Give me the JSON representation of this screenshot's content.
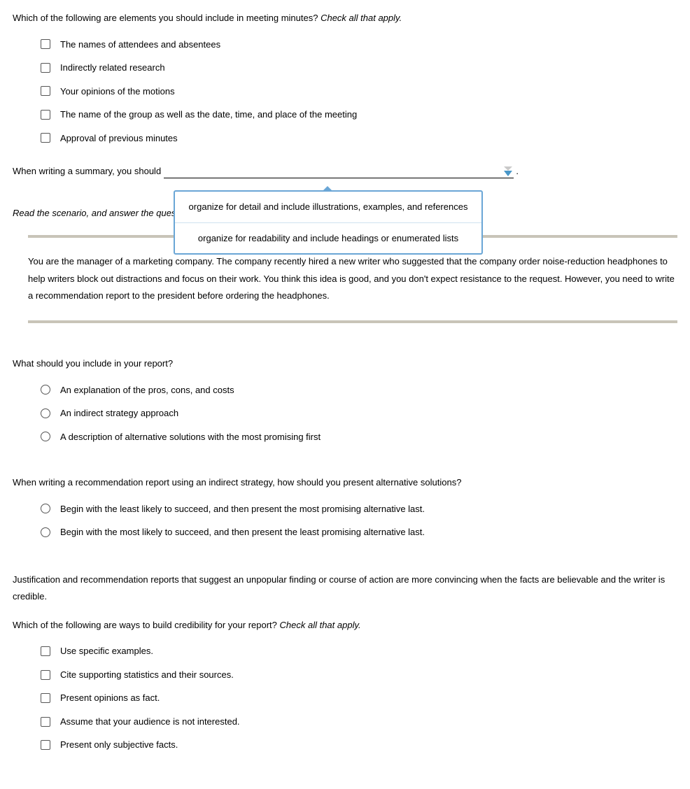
{
  "q1": {
    "text": "Which of the following are elements you should include in meeting minutes? ",
    "hint": "Check all that apply.",
    "options": [
      "The names of attendees and absentees",
      "Indirectly related research",
      "Your opinions of the motions",
      "The name of the group as well as the date, time, and place of the meeting",
      "Approval of previous minutes"
    ]
  },
  "q2": {
    "before": "When writing a summary, you should ",
    "after": " .",
    "dropdown": [
      "organize for detail and include illustrations, examples, and references",
      "organize for readability and include headings or enumerated lists"
    ]
  },
  "scenario": {
    "prompt": "Read the scenario, and answer the question.",
    "body": "You are the manager of a marketing company. The company recently hired a new writer who suggested that the company order noise-reduction headphones to help writers block out distractions and focus on their work. You think this idea is good, and you don't expect resistance to the request. However, you need to write a recommendation report to the president before ordering the headphones."
  },
  "q3": {
    "text": "What should you include in your report?",
    "options": [
      "An explanation of the pros, cons, and costs",
      "An indirect strategy approach",
      "A description of alternative solutions with the most promising first"
    ]
  },
  "q4": {
    "text": "When writing a recommendation report using an indirect strategy, how should you present alternative solutions?",
    "options": [
      "Begin with the least likely to succeed, and then present the most promising alternative last.",
      "Begin with the most likely to succeed, and then present the least promising alternative last."
    ]
  },
  "q5": {
    "intro": "Justification and recommendation reports that suggest an unpopular finding or course of action are more convincing when the facts are believable and the writer is credible.",
    "text": " Which of the following are ways to build credibility for your report? ",
    "hint": "Check all that apply.",
    "options": [
      "Use specific examples.",
      "Cite supporting statistics and their sources.",
      "Present opinions as fact.",
      "Assume that your audience is not interested.",
      "Present only subjective facts."
    ]
  }
}
